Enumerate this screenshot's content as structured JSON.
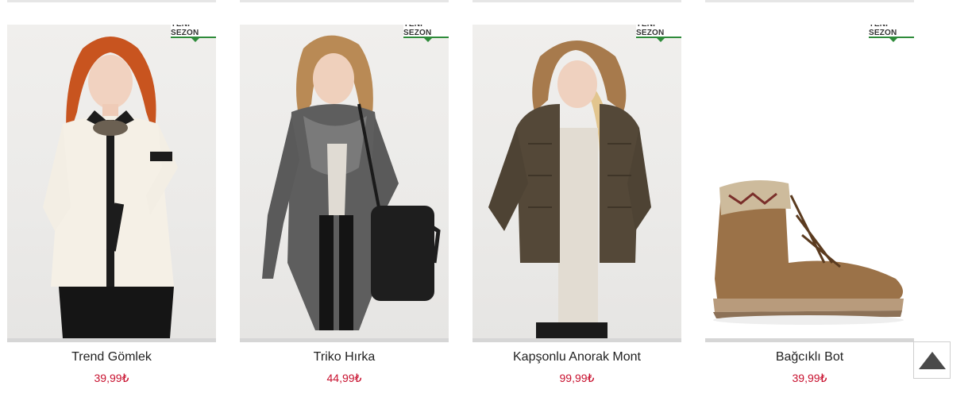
{
  "badge_label": "YENİ SEZON",
  "products": [
    {
      "name": "Trend Gömlek",
      "price": "39,99₺"
    },
    {
      "name": "Triko Hırka",
      "price": "44,99₺"
    },
    {
      "name": "Kapşonlu Anorak Mont",
      "price": "99,99₺"
    },
    {
      "name": "Bağcıklı Bot",
      "price": "39,99₺"
    }
  ],
  "colors": {
    "price": "#c8102e",
    "badge_line": "#2e8b3a"
  },
  "scroll_top": {
    "icon": "arrow-up-icon"
  }
}
